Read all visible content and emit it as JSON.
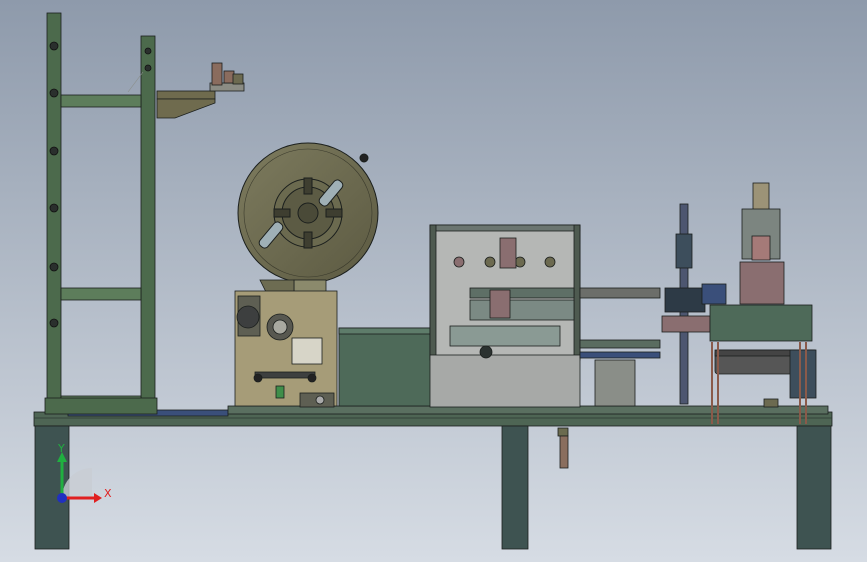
{
  "viewport": {
    "background_top": "#8e9aab",
    "background_bottom": "#d6dce4"
  },
  "colors": {
    "frame_green": "#4c6a4c",
    "frame_light": "#5d7d5b",
    "dark_slate": "#3e5351",
    "olive": "#6f6b4e",
    "steel": "#9ea6ae",
    "grey_panel": "#b7b8b5",
    "tan": "#9c9377",
    "blue_accent": "#3a4f7a",
    "outline": "#1b1f1d"
  },
  "triad": {
    "x_label": "X",
    "y_label": "Y",
    "x_color": "#e02020",
    "y_color": "#20b040",
    "z_color": "#2030c0"
  }
}
